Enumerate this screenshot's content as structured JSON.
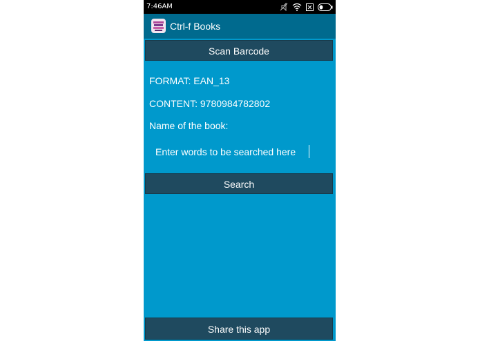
{
  "status_bar": {
    "time": "7:46AM",
    "icons": [
      "mute-icon",
      "wifi-icon",
      "no-sim-icon",
      "battery-icon"
    ]
  },
  "action_bar": {
    "title": "Ctrl-f Books",
    "icon": "book-icon"
  },
  "main": {
    "scan_button": "Scan Barcode",
    "format_text": "FORMAT: EAN_13",
    "content_text": "CONTENT: 9780984782802",
    "name_label": "Name of the book:",
    "search_placeholder": "Enter words to be searched here",
    "search_button": "Search"
  },
  "footer": {
    "share_button": "Share this app"
  },
  "colors": {
    "background": "#0099cc",
    "action_bar": "#006a8e",
    "button": "#1f4a5f",
    "status_bar": "#000000"
  }
}
